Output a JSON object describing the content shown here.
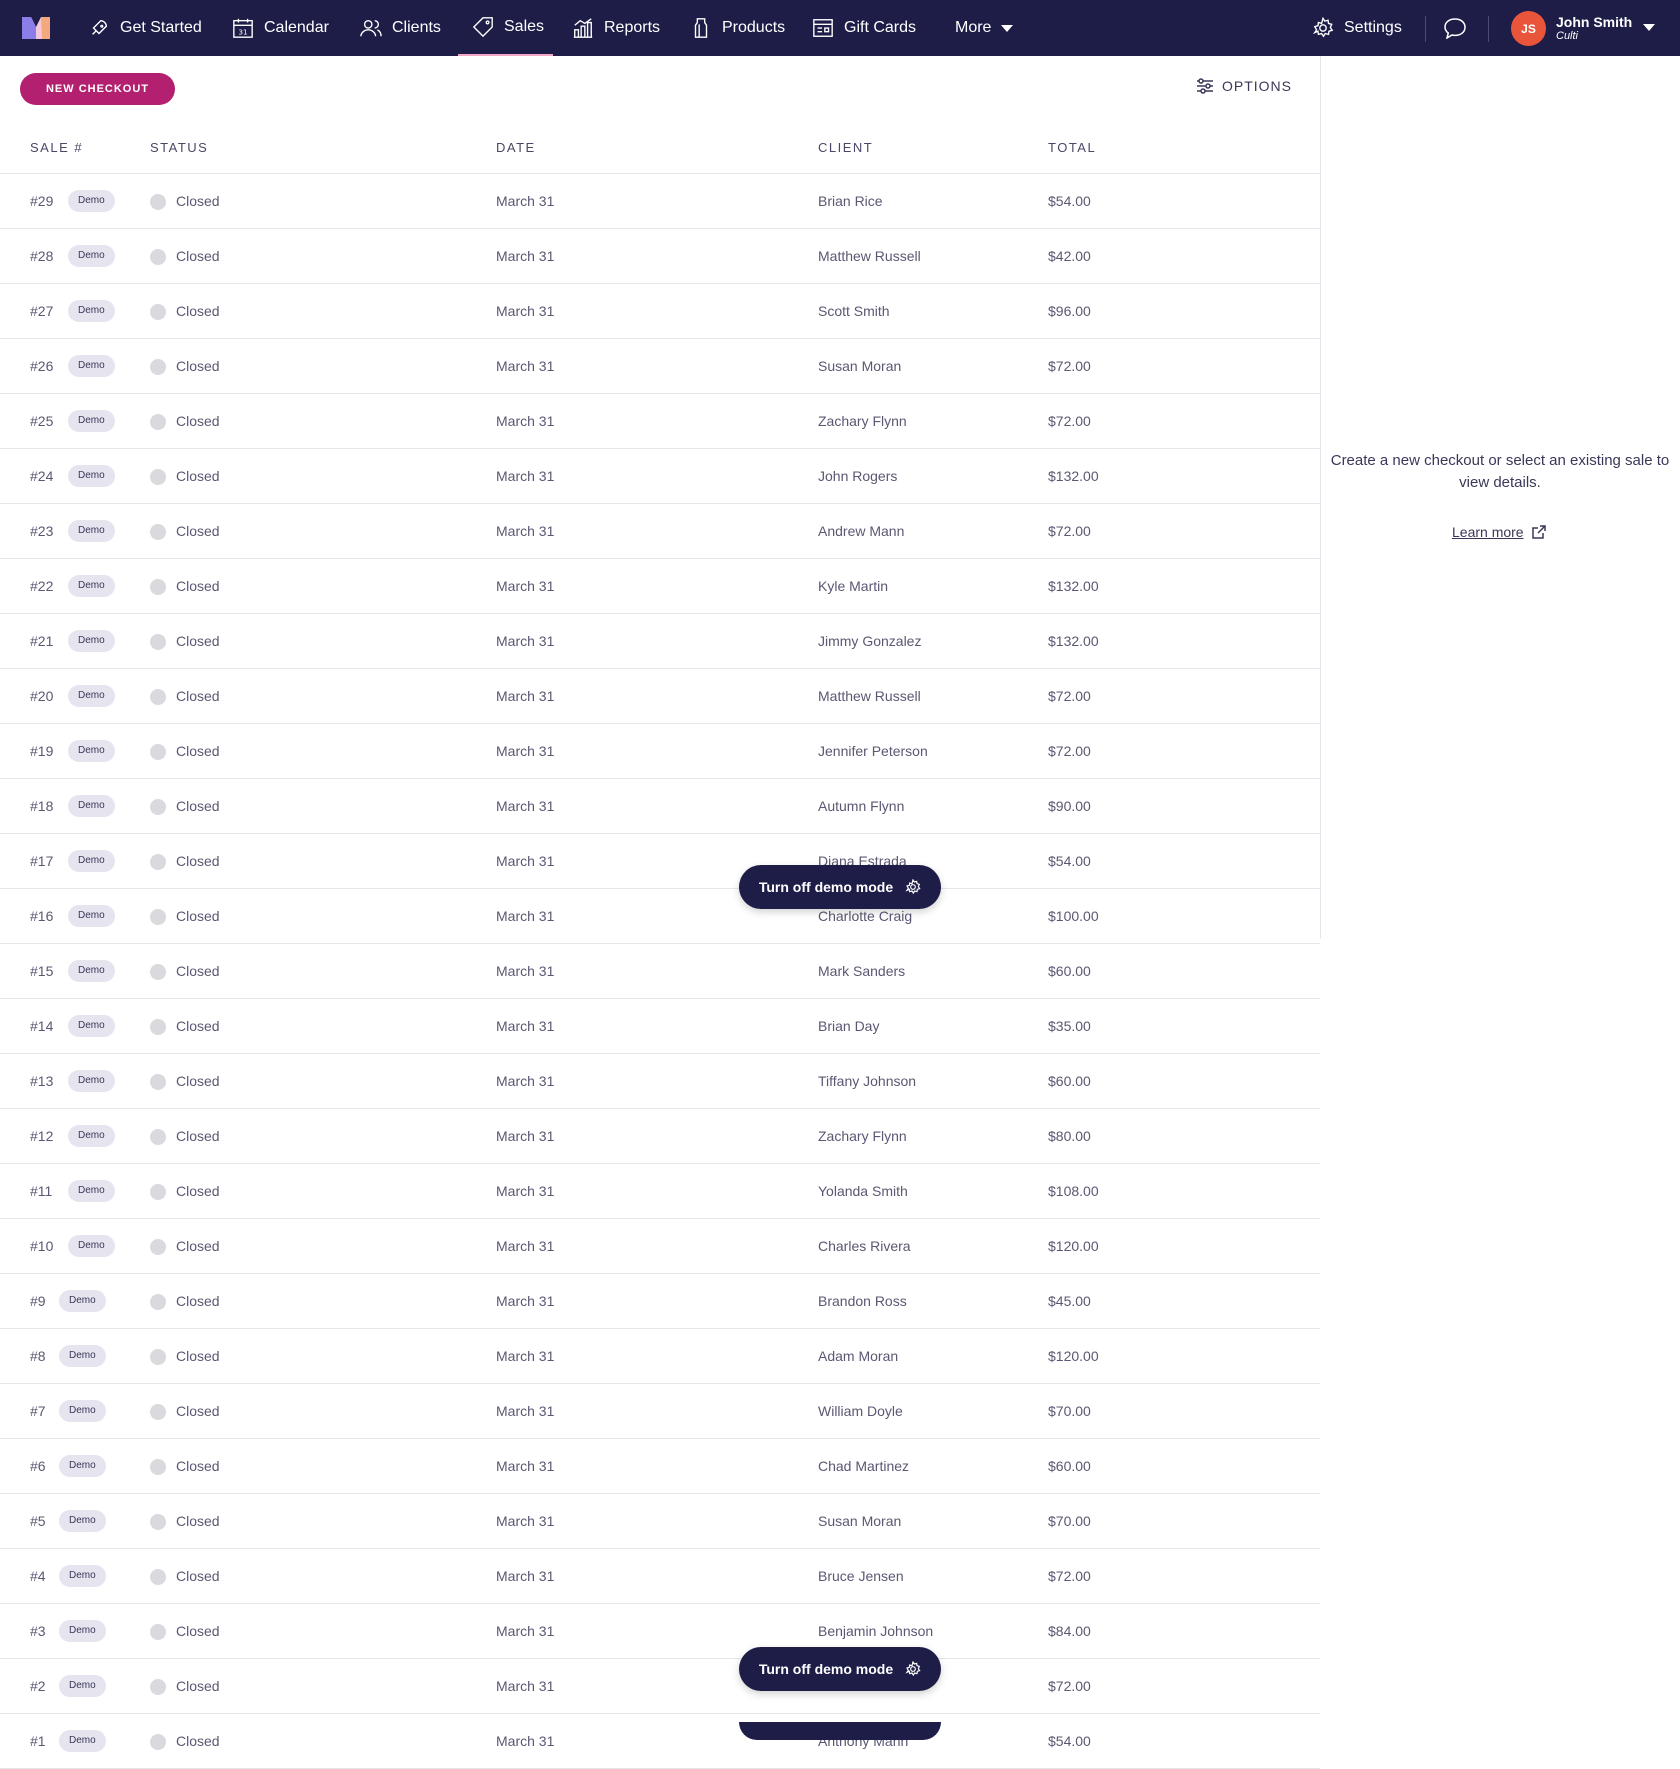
{
  "nav": {
    "items": [
      {
        "label": "Get Started",
        "icon": "rocket-icon"
      },
      {
        "label": "Calendar",
        "icon": "calendar-icon"
      },
      {
        "label": "Clients",
        "icon": "clients-icon"
      },
      {
        "label": "Sales",
        "icon": "tag-icon"
      },
      {
        "label": "Reports",
        "icon": "bar-chart-icon"
      },
      {
        "label": "Products",
        "icon": "bottle-icon"
      },
      {
        "label": "Gift Cards",
        "icon": "gift-card-icon"
      },
      {
        "label": "More",
        "icon": "chevron-down-icon"
      }
    ],
    "settings": "Settings",
    "calendar_day": "31",
    "user": {
      "initials": "JS",
      "name": "John Smith",
      "org": "Culti"
    }
  },
  "toolbar": {
    "new_checkout": "NEW CHECKOUT",
    "options": "OPTIONS"
  },
  "table": {
    "headers": {
      "sale": "SALE #",
      "status": "STATUS",
      "date": "DATE",
      "client": "CLIENT",
      "total": "TOTAL"
    },
    "rows": [
      {
        "num": "#29",
        "badge": "Demo",
        "status": "Closed",
        "date": "March 31",
        "client": "Brian Rice",
        "total": "$54.00"
      },
      {
        "num": "#28",
        "badge": "Demo",
        "status": "Closed",
        "date": "March 31",
        "client": "Matthew Russell",
        "total": "$42.00"
      },
      {
        "num": "#27",
        "badge": "Demo",
        "status": "Closed",
        "date": "March 31",
        "client": "Scott Smith",
        "total": "$96.00"
      },
      {
        "num": "#26",
        "badge": "Demo",
        "status": "Closed",
        "date": "March 31",
        "client": "Susan Moran",
        "total": "$72.00"
      },
      {
        "num": "#25",
        "badge": "Demo",
        "status": "Closed",
        "date": "March 31",
        "client": "Zachary Flynn",
        "total": "$72.00"
      },
      {
        "num": "#24",
        "badge": "Demo",
        "status": "Closed",
        "date": "March 31",
        "client": "John Rogers",
        "total": "$132.00"
      },
      {
        "num": "#23",
        "badge": "Demo",
        "status": "Closed",
        "date": "March 31",
        "client": "Andrew Mann",
        "total": "$72.00"
      },
      {
        "num": "#22",
        "badge": "Demo",
        "status": "Closed",
        "date": "March 31",
        "client": "Kyle Martin",
        "total": "$132.00"
      },
      {
        "num": "#21",
        "badge": "Demo",
        "status": "Closed",
        "date": "March 31",
        "client": "Jimmy Gonzalez",
        "total": "$132.00"
      },
      {
        "num": "#20",
        "badge": "Demo",
        "status": "Closed",
        "date": "March 31",
        "client": "Matthew Russell",
        "total": "$72.00"
      },
      {
        "num": "#19",
        "badge": "Demo",
        "status": "Closed",
        "date": "March 31",
        "client": "Jennifer Peterson",
        "total": "$72.00"
      },
      {
        "num": "#18",
        "badge": "Demo",
        "status": "Closed",
        "date": "March 31",
        "client": "Autumn Flynn",
        "total": "$90.00"
      },
      {
        "num": "#17",
        "badge": "Demo",
        "status": "Closed",
        "date": "March 31",
        "client": "Diana Estrada",
        "total": "$54.00"
      },
      {
        "num": "#16",
        "badge": "Demo",
        "status": "Closed",
        "date": "March 31",
        "client": "Charlotte Craig",
        "total": "$100.00"
      },
      {
        "num": "#15",
        "badge": "Demo",
        "status": "Closed",
        "date": "March 31",
        "client": "Mark Sanders",
        "total": "$60.00"
      },
      {
        "num": "#14",
        "badge": "Demo",
        "status": "Closed",
        "date": "March 31",
        "client": "Brian Day",
        "total": "$35.00"
      },
      {
        "num": "#13",
        "badge": "Demo",
        "status": "Closed",
        "date": "March 31",
        "client": "Tiffany Johnson",
        "total": "$60.00"
      },
      {
        "num": "#12",
        "badge": "Demo",
        "status": "Closed",
        "date": "March 31",
        "client": "Zachary Flynn",
        "total": "$80.00"
      },
      {
        "num": "#11",
        "badge": "Demo",
        "status": "Closed",
        "date": "March 31",
        "client": "Yolanda Smith",
        "total": "$108.00"
      },
      {
        "num": "#10",
        "badge": "Demo",
        "status": "Closed",
        "date": "March 31",
        "client": "Charles Rivera",
        "total": "$120.00"
      },
      {
        "num": "#9",
        "badge": "Demo",
        "status": "Closed",
        "date": "March 31",
        "client": "Brandon Ross",
        "total": "$45.00"
      },
      {
        "num": "#8",
        "badge": "Demo",
        "status": "Closed",
        "date": "March 31",
        "client": "Adam Moran",
        "total": "$120.00"
      },
      {
        "num": "#7",
        "badge": "Demo",
        "status": "Closed",
        "date": "March 31",
        "client": "William Doyle",
        "total": "$70.00"
      },
      {
        "num": "#6",
        "badge": "Demo",
        "status": "Closed",
        "date": "March 31",
        "client": "Chad Martinez",
        "total": "$60.00"
      },
      {
        "num": "#5",
        "badge": "Demo",
        "status": "Closed",
        "date": "March 31",
        "client": "Susan Moran",
        "total": "$70.00"
      },
      {
        "num": "#4",
        "badge": "Demo",
        "status": "Closed",
        "date": "March 31",
        "client": "Bruce Jensen",
        "total": "$72.00"
      },
      {
        "num": "#3",
        "badge": "Demo",
        "status": "Closed",
        "date": "March 31",
        "client": "Benjamin Johnson",
        "total": "$84.00"
      },
      {
        "num": "#2",
        "badge": "Demo",
        "status": "Closed",
        "date": "March 31",
        "client": "",
        "total": "$72.00"
      },
      {
        "num": "#1",
        "badge": "Demo",
        "status": "Closed",
        "date": "March 31",
        "client": "Anthony Mann",
        "total": "$54.00"
      }
    ]
  },
  "side_panel": {
    "message": "Create a new checkout or select an existing sale to view details.",
    "learn_more": "Learn more"
  },
  "demo_pill": {
    "label": "Turn off demo mode"
  },
  "colors": {
    "nav_bg": "#1e1d48",
    "accent": "#b3206f",
    "avatar": "#e8553b"
  }
}
